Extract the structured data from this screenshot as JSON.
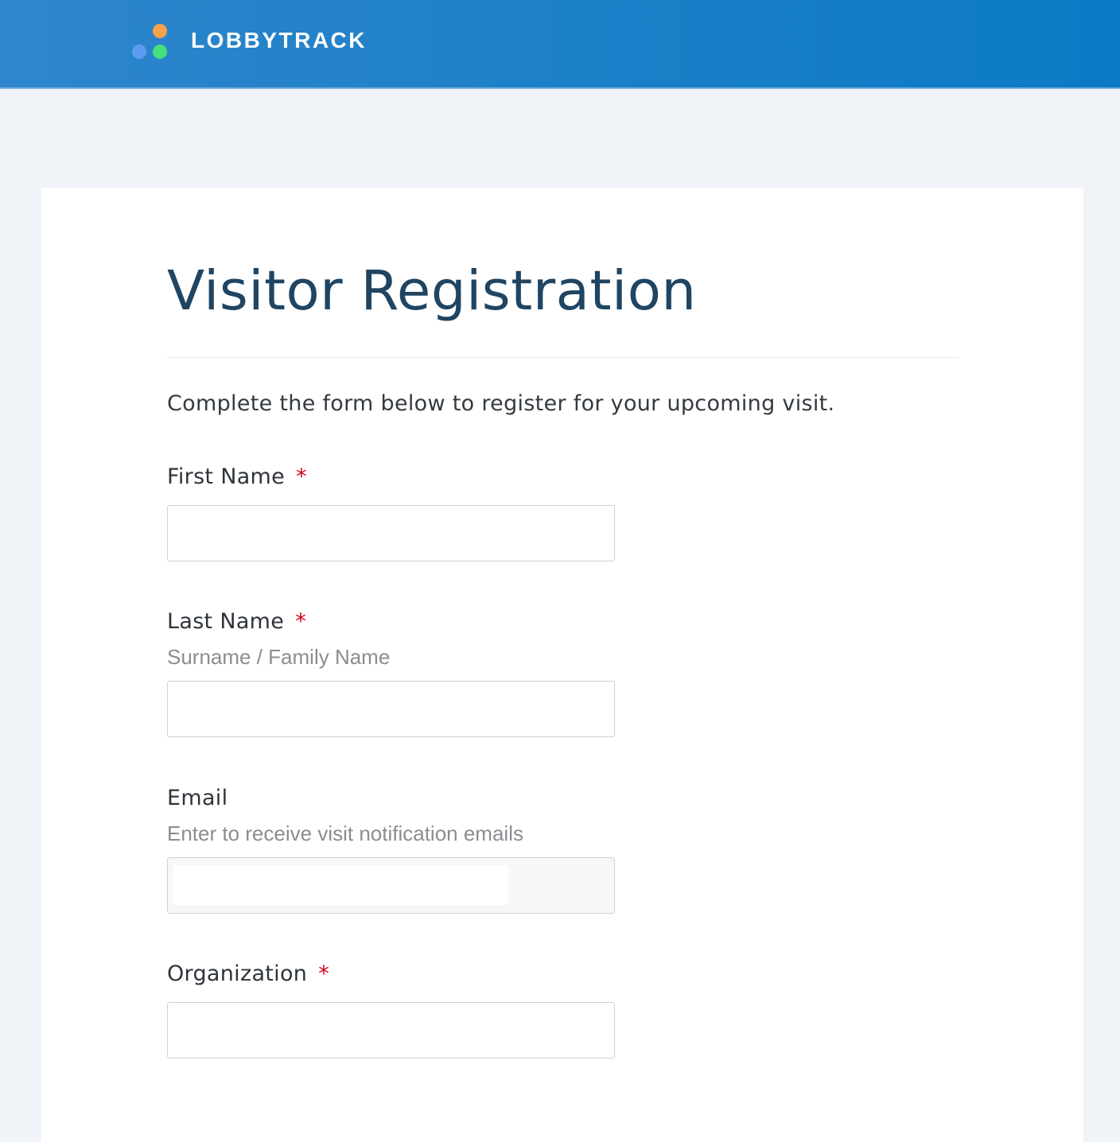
{
  "header": {
    "brand": "LOBBYTRACK",
    "logo_icon": "lobbytrack-logo-icon",
    "logo_colors": {
      "orange": "#f5a24a",
      "blue": "#5b9cf2",
      "green": "#47e07c"
    }
  },
  "form": {
    "title": "Visitor Registration",
    "intro": "Complete the form below to register for your upcoming visit.",
    "required_marker": "*",
    "fields": {
      "first_name": {
        "label": "First Name",
        "value": "",
        "required": true
      },
      "last_name": {
        "label": "Last Name",
        "hint": "Surname / Family Name",
        "value": "",
        "required": true
      },
      "email": {
        "label": "Email",
        "hint": "Enter to receive visit notification emails",
        "value": "",
        "required": false
      },
      "organization": {
        "label": "Organization",
        "value": "",
        "required": true
      }
    }
  },
  "colors": {
    "header_gradient_start": "#2f86cc",
    "header_gradient_end": "#0a7ac4",
    "page_background": "#f0f3f8",
    "title_color": "#1f4563",
    "required_color": "#d0021b"
  }
}
